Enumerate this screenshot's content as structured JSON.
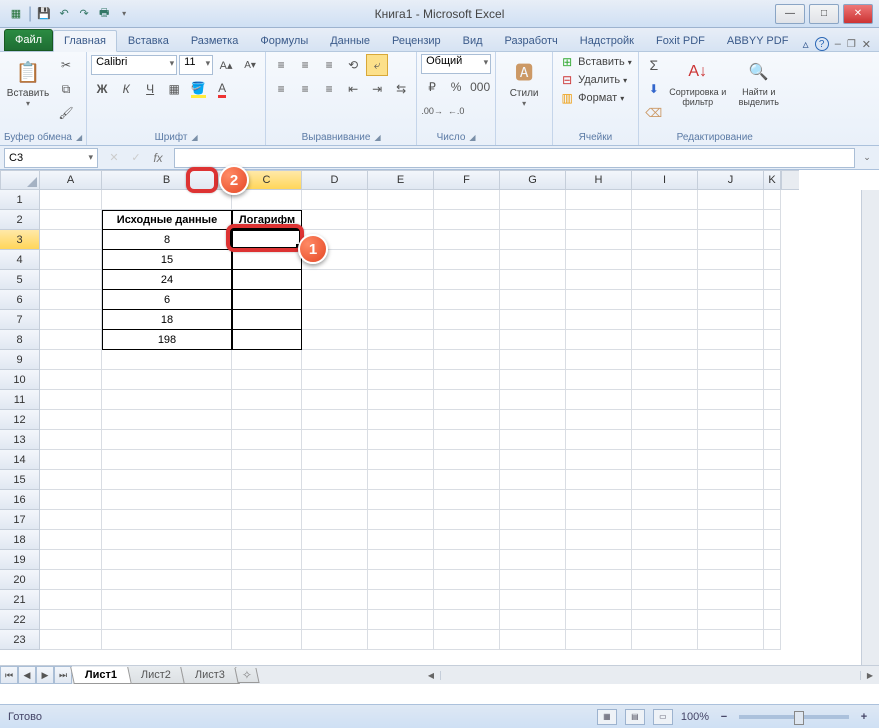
{
  "window_title": "Книга1  -  Microsoft Excel",
  "qat": {
    "save": "💾",
    "undo": "↶",
    "redo": "↷",
    "print": "🖶"
  },
  "tabs": {
    "file": "Файл",
    "items": [
      "Главная",
      "Вставка",
      "Разметка",
      "Формулы",
      "Данные",
      "Рецензир",
      "Вид",
      "Разработч",
      "Надстройк",
      "Foxit PDF",
      "ABBYY PDF"
    ],
    "active_index": 0
  },
  "ribbon": {
    "clipboard": {
      "paste": "Вставить",
      "label": "Буфер обмена"
    },
    "font": {
      "name": "Calibri",
      "size": "11",
      "bold": "Ж",
      "italic": "К",
      "underline": "Ч",
      "label": "Шрифт"
    },
    "alignment": {
      "label": "Выравнивание"
    },
    "number": {
      "format": "Общий",
      "label": "Число"
    },
    "styles": {
      "btn": "Стили",
      "label": ""
    },
    "cells": {
      "insert": "Вставить",
      "delete": "Удалить",
      "format": "Формат",
      "label": "Ячейки"
    },
    "editing": {
      "sort": "Сортировка и фильтр",
      "find": "Найти и выделить",
      "label": "Редактирование"
    }
  },
  "formula_bar": {
    "name_box": "C3",
    "fx": "fx",
    "value": ""
  },
  "columns": [
    "A",
    "B",
    "C",
    "D",
    "E",
    "F",
    "G",
    "H",
    "I",
    "J",
    "K"
  ],
  "active_col": "C",
  "active_row": 3,
  "data": {
    "header_b": "Исходные данные",
    "header_c": "Логарифм",
    "rows": [
      {
        "r": 3,
        "b": "8"
      },
      {
        "r": 4,
        "b": "15"
      },
      {
        "r": 5,
        "b": "24"
      },
      {
        "r": 6,
        "b": "6"
      },
      {
        "r": 7,
        "b": "18"
      },
      {
        "r": 8,
        "b": "198"
      }
    ]
  },
  "row_count": 23,
  "sheets": {
    "items": [
      "Лист1",
      "Лист2",
      "Лист3"
    ],
    "active_index": 0
  },
  "status": {
    "ready": "Готово",
    "zoom": "100%"
  },
  "callouts": {
    "c1": "1",
    "c2": "2"
  }
}
